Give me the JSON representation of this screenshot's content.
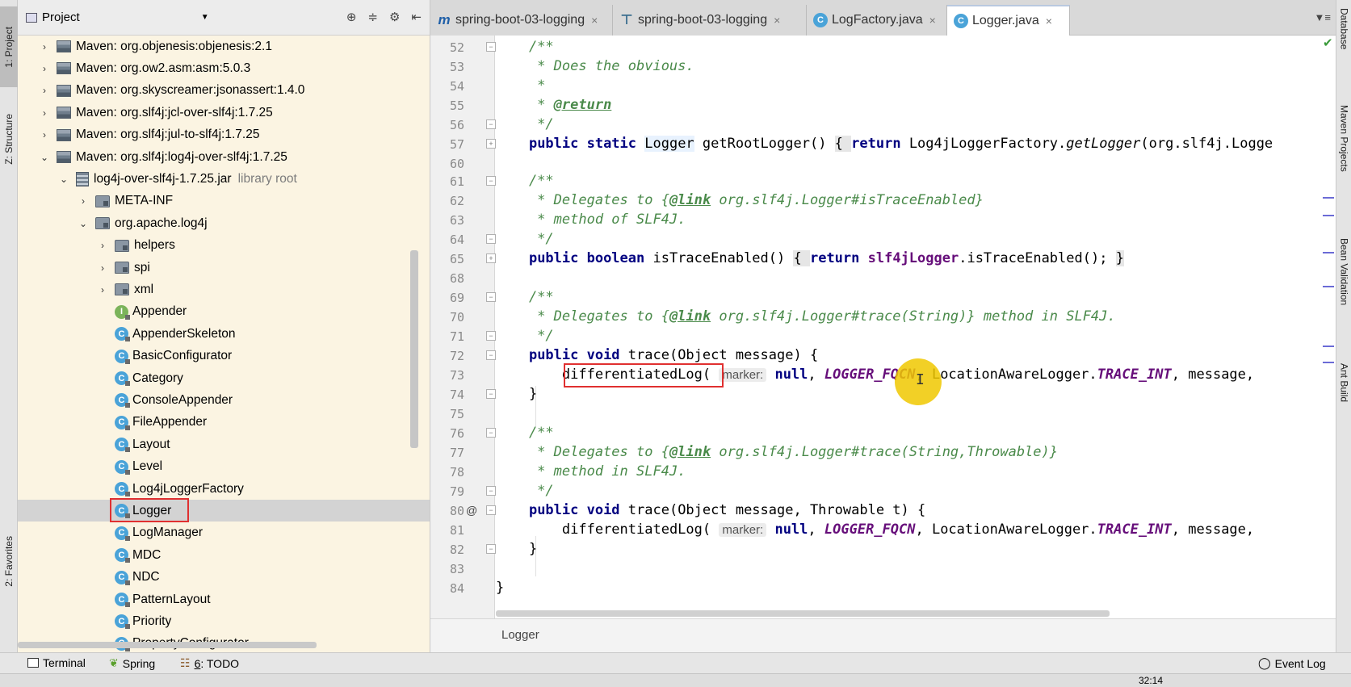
{
  "left_strip": {
    "project": "1: Project",
    "structure": "Z: Structure",
    "favorites": "2: Favorites"
  },
  "right_strip": {
    "database": "Database",
    "maven": "Maven Projects",
    "bean": "Bean Validation",
    "ant": "Ant Build"
  },
  "project_panel": {
    "title": "Project",
    "tree": [
      {
        "label": "Maven: org.objenesis:objenesis:2.1",
        "type": "lib",
        "arrow": "›",
        "indent": 0
      },
      {
        "label": "Maven: org.ow2.asm:asm:5.0.3",
        "type": "lib",
        "arrow": "›",
        "indent": 0
      },
      {
        "label": "Maven: org.skyscreamer:jsonassert:1.4.0",
        "type": "lib",
        "arrow": "›",
        "indent": 0
      },
      {
        "label": "Maven: org.slf4j:jcl-over-slf4j:1.7.25",
        "type": "lib",
        "arrow": "›",
        "indent": 0
      },
      {
        "label": "Maven: org.slf4j:jul-to-slf4j:1.7.25",
        "type": "lib",
        "arrow": "›",
        "indent": 0
      },
      {
        "label": "Maven: org.slf4j:log4j-over-slf4j:1.7.25",
        "type": "lib",
        "arrow": "⌄",
        "indent": 0
      },
      {
        "label": "log4j-over-slf4j-1.7.25.jar",
        "type": "jar",
        "arrow": "⌄",
        "indent": 1,
        "extra": "library root"
      },
      {
        "label": "META-INF",
        "type": "folder",
        "arrow": "›",
        "indent": 2
      },
      {
        "label": "org.apache.log4j",
        "type": "folder",
        "arrow": "⌄",
        "indent": 2
      },
      {
        "label": "helpers",
        "type": "folder",
        "arrow": "›",
        "indent": 3
      },
      {
        "label": "spi",
        "type": "folder",
        "arrow": "›",
        "indent": 3
      },
      {
        "label": "xml",
        "type": "folder",
        "arrow": "›",
        "indent": 3
      },
      {
        "label": "Appender",
        "type": "iface",
        "arrow": "",
        "indent": 3
      },
      {
        "label": "AppenderSkeleton",
        "type": "class",
        "arrow": "",
        "indent": 3
      },
      {
        "label": "BasicConfigurator",
        "type": "class",
        "arrow": "",
        "indent": 3
      },
      {
        "label": "Category",
        "type": "class",
        "arrow": "",
        "indent": 3
      },
      {
        "label": "ConsoleAppender",
        "type": "class",
        "arrow": "",
        "indent": 3
      },
      {
        "label": "FileAppender",
        "type": "class",
        "arrow": "",
        "indent": 3
      },
      {
        "label": "Layout",
        "type": "class",
        "arrow": "",
        "indent": 3
      },
      {
        "label": "Level",
        "type": "class",
        "arrow": "",
        "indent": 3
      },
      {
        "label": "Log4jLoggerFactory",
        "type": "class",
        "arrow": "",
        "indent": 3
      },
      {
        "label": "Logger",
        "type": "class",
        "arrow": "",
        "indent": 3,
        "selected": true
      },
      {
        "label": "LogManager",
        "type": "class",
        "arrow": "",
        "indent": 3
      },
      {
        "label": "MDC",
        "type": "class",
        "arrow": "",
        "indent": 3
      },
      {
        "label": "NDC",
        "type": "class",
        "arrow": "",
        "indent": 3
      },
      {
        "label": "PatternLayout",
        "type": "class",
        "arrow": "",
        "indent": 3
      },
      {
        "label": "Priority",
        "type": "class",
        "arrow": "",
        "indent": 3
      },
      {
        "label": "PropertyConfigurator",
        "type": "class",
        "arrow": "",
        "indent": 3
      }
    ]
  },
  "tabs": [
    {
      "label": "spring-boot-03-logging",
      "icon": "m"
    },
    {
      "label": "spring-boot-03-logging",
      "icon": "t"
    },
    {
      "label": "LogFactory.java",
      "icon": "c"
    },
    {
      "label": "Logger.java",
      "icon": "c",
      "active": true
    }
  ],
  "editor": {
    "line_numbers": [
      "52",
      "53",
      "54",
      "55",
      "56",
      "57",
      "60",
      "61",
      "62",
      "63",
      "64",
      "65",
      "68",
      "69",
      "70",
      "71",
      "72",
      "73",
      "74",
      "75",
      "76",
      "77",
      "78",
      "79",
      "80",
      "81",
      "82",
      "83",
      "84"
    ],
    "lines": {
      "l52": "    /**",
      "l53": "     * Does the obvious.",
      "l54": "     *",
      "l55a": "     * ",
      "l55tag": "@return",
      "l56": "     */",
      "l57a": "public static ",
      "l57b": "Logger",
      "l57c": " getRootLogger() ",
      "l57d": "{ ",
      "l57e": "return ",
      "l57f": "Log4jLoggerFactory.",
      "l57g": "getLogger",
      "l57h": "(org.slf4j.Logge",
      "l61": "    /**",
      "l62a": "     * Delegates to {",
      "l62tag": "@link",
      "l62b": " org.slf4j.Logger#isTraceEnabled}",
      "l63": "     * method of SLF4J.",
      "l64": "     */",
      "l65a": "public boolean ",
      "l65b": "isTraceEnabled() ",
      "l65c": "{ ",
      "l65d": "return ",
      "l65e": "slf4jLogger",
      "l65f": ".isTraceEnabled(); ",
      "l65g": "}",
      "l69": "    /**",
      "l70a": "     * Delegates to {",
      "l70tag": "@link",
      "l70b": " org.slf4j.Logger#trace(String)} method in SLF4J.",
      "l71": "     */",
      "l72a": "public void ",
      "l72b": "trace(Object message) {",
      "l73a": "differentiatedLog(",
      "l73hint": "marker:",
      "l73b": " null",
      "l73c": ", ",
      "l73d": "LOGGER_FQCN",
      "l73e": ", LocationAwareLogger.",
      "l73f": "TRACE_INT",
      "l73g": ", message,",
      "l74": "}",
      "l76": "    /**",
      "l77a": "     * Delegates to {",
      "l77tag": "@link",
      "l77b": " org.slf4j.Logger#trace(String,Throwable)}",
      "l78": "     * method in SLF4J.",
      "l79": "     */",
      "l80a": "public void ",
      "l80b": "trace(Object message, Throwable t) {",
      "l81a": "differentiatedLog(",
      "l81hint": "marker:",
      "l81b": " null",
      "l81c": ", ",
      "l81d": "LOGGER_FQCN",
      "l81e": ", LocationAwareLogger.",
      "l81f": "TRACE_INT",
      "l81g": ", message,",
      "l82": "}",
      "l84": "}"
    },
    "override_mark": "@",
    "breadcrumb": "Logger"
  },
  "bottom_bar": {
    "terminal": "Terminal",
    "spring": "Spring",
    "todo_num": "6",
    "todo": ": TODO",
    "event_log": "Event Log"
  },
  "status_bar": {
    "position": "32:14"
  },
  "colors": {
    "highlight_box": "#e03030",
    "cursor": "#f0c800",
    "keyword": "#000080",
    "comment": "#4a8a4a",
    "constant": "#660e7a"
  }
}
